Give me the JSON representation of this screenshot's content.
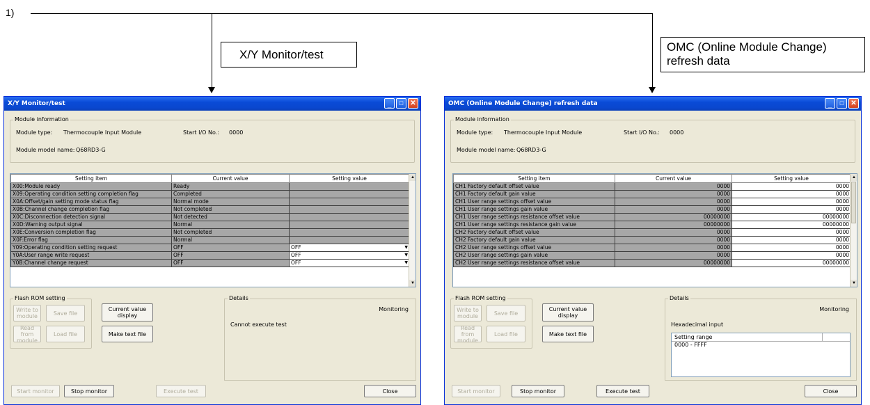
{
  "callout": {
    "marker": "1)",
    "xy_label": "X/Y Monitor/test",
    "omc_label_line1": "OMC (Online Module Change)",
    "omc_label_line2": "refresh data"
  },
  "xy_window": {
    "title": "X/Y Monitor/test",
    "module_info_title": "Module information",
    "module_type_label": "Module type:",
    "module_type_value": "Thermocouple Input Module",
    "start_io_label": "Start I/O No.:",
    "start_io_value": "0000",
    "model_label": "Module model name:",
    "model_value": "Q68RD3-G",
    "headers": [
      "Setting item",
      "Current value",
      "Setting value"
    ],
    "rows": [
      {
        "item": "X00:Module ready",
        "current": "Ready",
        "setting": ""
      },
      {
        "item": "X09:Operating condition setting completion flag",
        "current": "Completed",
        "setting": ""
      },
      {
        "item": "X0A:Offset/gain setting mode status flag",
        "current": "Normal mode",
        "setting": ""
      },
      {
        "item": "X0B:Channel change completion flag",
        "current": "Not completed",
        "setting": ""
      },
      {
        "item": "X0C:Disconnection detection signal",
        "current": "Not detected",
        "setting": ""
      },
      {
        "item": "X0D:Warning output signal",
        "current": "Normal",
        "setting": ""
      },
      {
        "item": "X0E:Conversion completion flag",
        "current": "Not completed",
        "setting": ""
      },
      {
        "item": "X0F:Error flag",
        "current": "Normal",
        "setting": ""
      },
      {
        "item": "Y09:Operating condition setting request",
        "current": "OFF",
        "setting": "OFF"
      },
      {
        "item": "Y0A:User range write request",
        "current": "OFF",
        "setting": "OFF"
      },
      {
        "item": "Y0B:Channel change request",
        "current": "OFF",
        "setting": "OFF"
      }
    ],
    "flash_title": "Flash ROM setting",
    "write_to_module": "Write to module",
    "save_file": "Save file",
    "read_from_module": "Read from module",
    "load_file": "Load file",
    "current_value_display": "Current value display",
    "make_text_file": "Make text file",
    "details_title": "Details",
    "monitoring": "Monitoring",
    "details_text": "Cannot execute test",
    "start_monitor": "Start monitor",
    "stop_monitor": "Stop monitor",
    "execute_test": "Execute test",
    "close": "Close"
  },
  "omc_window": {
    "title": "OMC (Online Module Change) refresh data",
    "module_info_title": "Module information",
    "module_type_label": "Module type:",
    "module_type_value": "Thermocouple Input Module",
    "start_io_label": "Start I/O No.:",
    "start_io_value": "0000",
    "model_label": "Module model name:",
    "model_value": "Q68RD3-G",
    "headers": [
      "Setting item",
      "Current value",
      "Setting value"
    ],
    "rows": [
      {
        "item": "CH1 Factory default offset value",
        "current": "0000",
        "setting": "0000"
      },
      {
        "item": "CH1 Factory default gain value",
        "current": "0000",
        "setting": "0000"
      },
      {
        "item": "CH1 User range settings offset value",
        "current": "0000",
        "setting": "0000"
      },
      {
        "item": "CH1 User range settings gain value",
        "current": "0000",
        "setting": "0000"
      },
      {
        "item": "CH1 User range settings resistance offset value",
        "current": "00000000",
        "setting": "00000000"
      },
      {
        "item": "CH1 User range settings resistance gain value",
        "current": "00000000",
        "setting": "00000000"
      },
      {
        "item": "CH2 Factory default offset value",
        "current": "0000",
        "setting": "0000"
      },
      {
        "item": "CH2 Factory default gain value",
        "current": "0000",
        "setting": "0000"
      },
      {
        "item": "CH2 User range settings offset value",
        "current": "0000",
        "setting": "0000"
      },
      {
        "item": "CH2 User range settings gain value",
        "current": "0000",
        "setting": "0000"
      },
      {
        "item": "CH2 User range settings resistance offset value",
        "current": "00000000",
        "setting": "00000000"
      }
    ],
    "flash_title": "Flash ROM setting",
    "write_to_module": "Write to module",
    "save_file": "Save file",
    "read_from_module": "Read from module",
    "load_file": "Load file",
    "current_value_display": "Current value display",
    "make_text_file": "Make text file",
    "details_title": "Details",
    "monitoring": "Monitoring",
    "hex_input": "Hexadecimal input",
    "range_header": "Setting range",
    "range_value": "0000 - FFFF",
    "start_monitor": "Start monitor",
    "stop_monitor": "Stop monitor",
    "execute_test": "Execute test",
    "close": "Close"
  }
}
